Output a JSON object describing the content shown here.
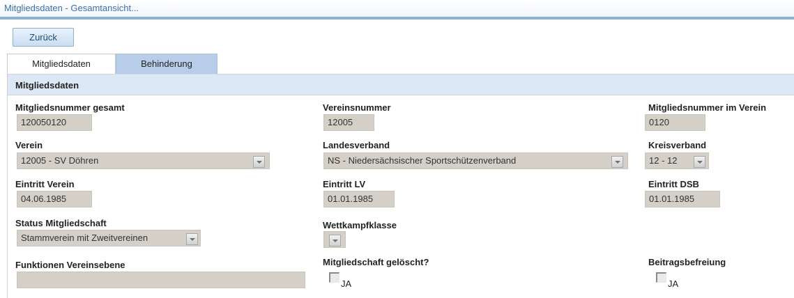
{
  "window": {
    "title": "Mitgliedsdaten - Gesamtansicht..."
  },
  "toolbar": {
    "back_label": "Zurück"
  },
  "tabs": [
    {
      "label": "Mitgliedsdaten",
      "active": true
    },
    {
      "label": "Behinderung",
      "active": false
    }
  ],
  "section": {
    "title": "Mitgliedsdaten"
  },
  "fields": {
    "mitgliedsnummer_gesamt": {
      "label": "Mitgliedsnummer gesamt",
      "value": "120050120"
    },
    "vereinsnummer": {
      "label": "Vereinsnummer",
      "value": "12005"
    },
    "mitgliedsnummer_verein": {
      "label": "Mitgliedsnummer im Verein",
      "value": "0120"
    },
    "verein": {
      "label": "Verein",
      "value": "12005 - SV Döhren"
    },
    "landesverband": {
      "label": "Landesverband",
      "value": "NS - Niedersächsischer Sportschützenverband"
    },
    "kreisverband": {
      "label": "Kreisverband",
      "value": "12 - 12"
    },
    "eintritt_verein": {
      "label": "Eintritt Verein",
      "value": "04.06.1985"
    },
    "eintritt_lv": {
      "label": "Eintritt LV",
      "value": "01.01.1985"
    },
    "eintritt_dsb": {
      "label": "Eintritt DSB",
      "value": "01.01.1985"
    },
    "status": {
      "label": "Status Mitgliedschaft",
      "value": "Stammverein mit Zweitvereinen"
    },
    "wettkampfklasse": {
      "label": "Wettkampfklasse",
      "value": ""
    },
    "funktionen": {
      "label": "Funktionen Vereinsebene",
      "value": ""
    },
    "geloescht": {
      "label": "Mitgliedschaft gelöscht?",
      "option": "JA",
      "checked": false
    },
    "beitragsbefreiung": {
      "label": "Beitragsbefreiung",
      "option": "JA",
      "checked": false
    }
  },
  "icons": {
    "dropdown": "chevron-down-icon"
  },
  "colors": {
    "accent": "#8cb0d4",
    "section_bg": "#dde8f5",
    "field_bg": "#d4d0c8",
    "tab_inactive": "#b8cde9"
  }
}
